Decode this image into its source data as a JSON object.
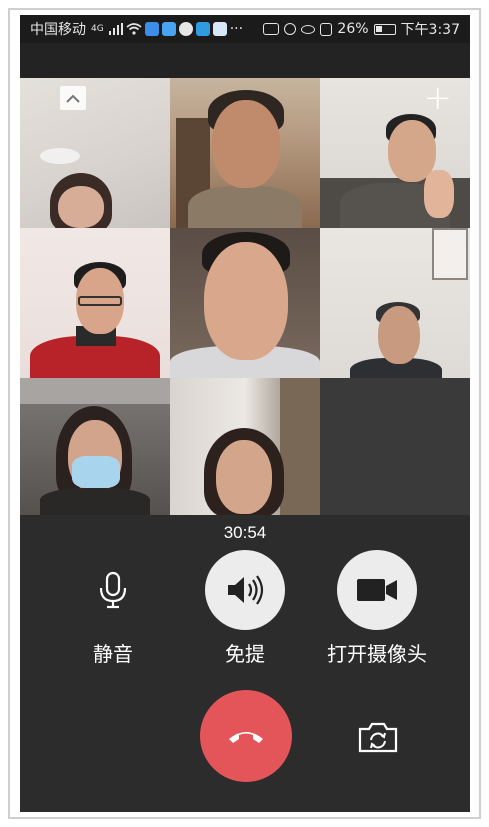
{
  "status_bar": {
    "carrier": "中国移动",
    "signal": "4G",
    "battery": "26%",
    "time": "下午3:37"
  },
  "call": {
    "timer": "30:54",
    "participants": 8
  },
  "controls": {
    "mute_label": "静音",
    "speaker_label": "免提",
    "camera_label": "打开摄像头"
  },
  "colors": {
    "background": "#2c2c2c",
    "hangup": "#e4555a",
    "active_button": "#ececec"
  },
  "icons": {
    "collapse": "chevron-up-icon",
    "add": "plus-icon",
    "mute": "microphone-icon",
    "speaker": "speaker-icon",
    "camera": "video-camera-icon",
    "hangup": "phone-hangup-icon",
    "flip": "camera-flip-icon"
  }
}
